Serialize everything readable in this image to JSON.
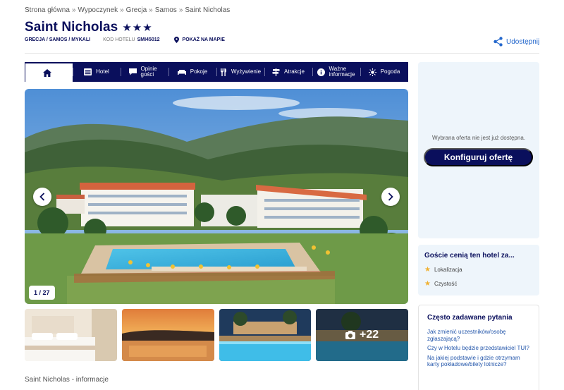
{
  "breadcrumb": [
    "Strona główna",
    "Wypoczynek",
    "Grecja",
    "Samos",
    "Saint Nicholas"
  ],
  "breadcrumb_sep": "»",
  "hotel": {
    "name": "Saint Nicholas",
    "stars": "★★★",
    "location": "GRECJA / SAMOS / MYKALI",
    "code_label": "KOD HOTELU",
    "code": "SMI45012",
    "map_link": "POKAŻ NA MAPIE"
  },
  "share_label": "Udostępnij",
  "tabs": [
    {
      "label": "",
      "icon": "home-icon"
    },
    {
      "label": "Hotel",
      "icon": "hotel-icon"
    },
    {
      "label": "Opinie gości",
      "icon": "chat-icon"
    },
    {
      "label": "Pokoje",
      "icon": "bed-icon"
    },
    {
      "label": "Wyżywienie",
      "icon": "cutlery-icon"
    },
    {
      "label": "Atrakcje",
      "icon": "signpost-icon"
    },
    {
      "label": "Ważne informacje",
      "icon": "info-icon"
    },
    {
      "label": "Pogoda",
      "icon": "sun-icon"
    }
  ],
  "gallery": {
    "counter": "1 / 27",
    "more_count": "+22"
  },
  "info_heading": "Saint Nicholas - informacje",
  "offer": {
    "message": "Wybrana oferta nie jest już dostępna.",
    "button": "Konfiguruj ofertę"
  },
  "ratings": {
    "title": "Goście cenią ten hotel za...",
    "items": [
      "Lokalizacja",
      "Czystość"
    ]
  },
  "faq": {
    "title": "Często zadawane pytania",
    "questions": [
      "Jak zmienić uczestników/osobę zgłaszającą?",
      "Czy w Hotelu będzie przedstawiciel TUI?",
      "Na jakiej podstawie i gdzie otrzymam karty pokładowe/bilety lotnicze?"
    ]
  },
  "colors": {
    "brand_navy": "#0a0f5c",
    "link_blue": "#2255aa",
    "panel_bg": "#eef5fb",
    "star_gold": "#f0b030"
  }
}
